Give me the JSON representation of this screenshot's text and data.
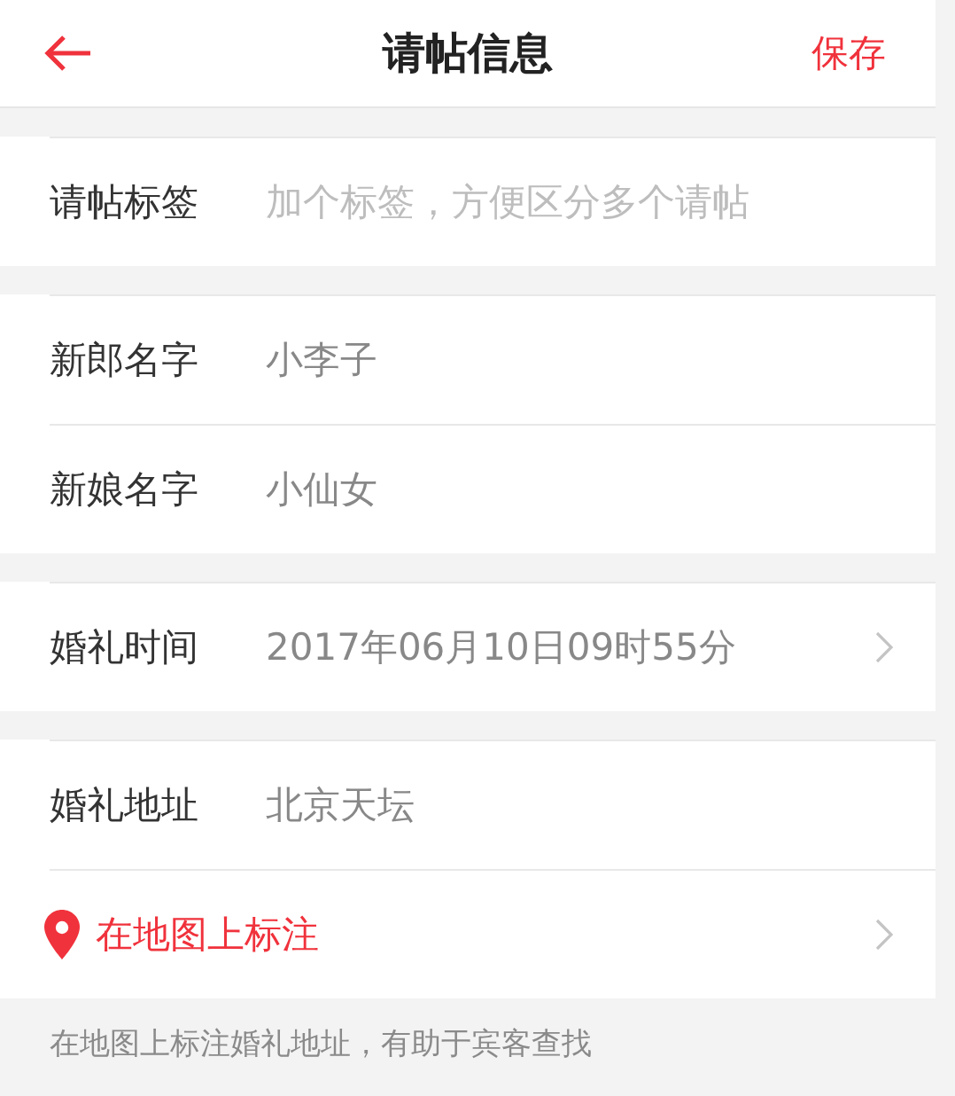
{
  "header": {
    "title": "请帖信息",
    "save": "保存"
  },
  "sections": [
    {
      "rows": [
        {
          "kind": "field",
          "label": "请帖标签",
          "placeholder": "加个标签，方便区分多个请帖"
        }
      ]
    },
    {
      "rows": [
        {
          "kind": "field",
          "label": "新郎名字",
          "value": "小李子"
        },
        {
          "kind": "field",
          "label": "新娘名字",
          "value": "小仙女"
        }
      ]
    },
    {
      "rows": [
        {
          "kind": "picker",
          "label": "婚礼时间",
          "value": "2017年06月10日09时55分"
        }
      ]
    },
    {
      "rows": [
        {
          "kind": "field",
          "label": "婚礼地址",
          "value": "北京天坛"
        },
        {
          "kind": "link",
          "label": "在地图上标注"
        }
      ]
    }
  ],
  "hint": "在地图上标注婚礼地址，有助于宾客查找"
}
